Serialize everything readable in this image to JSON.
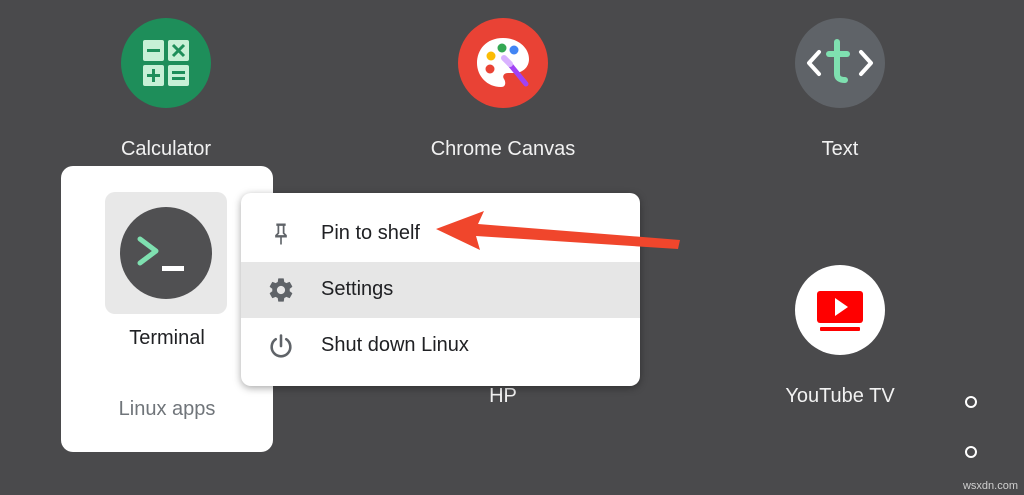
{
  "launcher": {
    "apps": [
      {
        "label": "Calculator"
      },
      {
        "label": "Chrome Canvas"
      },
      {
        "label": "Text"
      },
      {
        "label": "HP"
      },
      {
        "label": "YouTube TV"
      }
    ],
    "folder": {
      "name": "Linux apps",
      "app_label": "Terminal"
    }
  },
  "context_menu": {
    "items": [
      {
        "label": "Pin to shelf",
        "icon": "pin-icon"
      },
      {
        "label": "Settings",
        "icon": "gear-icon"
      },
      {
        "label": "Shut down Linux",
        "icon": "power-icon"
      }
    ]
  },
  "colors": {
    "background": "#4a4a4c",
    "calculator": "#1e8e5a",
    "canvas": "#e94235",
    "text_app": "#5f6368",
    "youtube_red": "#ff0000",
    "annotation_arrow": "#f0462c"
  },
  "watermark": "wsxdn.com"
}
